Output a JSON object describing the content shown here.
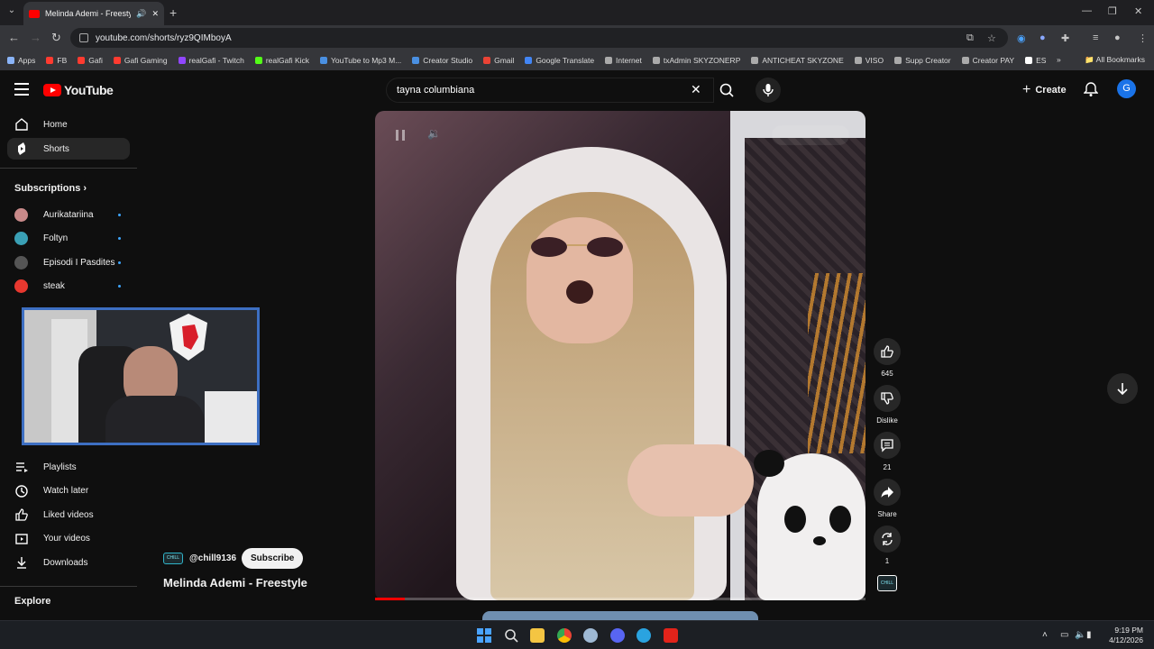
{
  "browser": {
    "tab_title": "Melinda Ademi - Freestyle",
    "tab_audio_icon": "speaker-icon",
    "new_tab_label": "+",
    "url": "youtube.com/shorts/ryz9QIMboyA",
    "bookmarks": [
      {
        "label": "Apps",
        "color": "#8ab4f8"
      },
      {
        "label": "FB",
        "color": "#ff3b30"
      },
      {
        "label": "Gafi",
        "color": "#ff3b30"
      },
      {
        "label": "Gafi Gaming",
        "color": "#ff3b30"
      },
      {
        "label": "realGafi - Twitch",
        "color": "#9146ff"
      },
      {
        "label": "realGafi Kick",
        "color": "#53fc18"
      },
      {
        "label": "YouTube to Mp3 M...",
        "color": "#4a90e2"
      },
      {
        "label": "Creator Studio",
        "color": "#4a90e2"
      },
      {
        "label": "Gmail",
        "color": "#ea4335"
      },
      {
        "label": "Google Translate",
        "color": "#4285f4"
      },
      {
        "label": "Internet",
        "color": "#aaaaaa"
      },
      {
        "label": "txAdmin SKYZONERP",
        "color": "#aaaaaa"
      },
      {
        "label": "ANTICHEAT SKYZONE",
        "color": "#aaaaaa"
      },
      {
        "label": "VISO",
        "color": "#aaaaaa"
      },
      {
        "label": "Supp Creator",
        "color": "#aaaaaa"
      },
      {
        "label": "Creator PAY",
        "color": "#aaaaaa"
      },
      {
        "label": "ES",
        "color": "#ffffff"
      }
    ],
    "all_bookmarks_label": "All Bookmarks"
  },
  "youtube": {
    "logo_text": "YouTube",
    "search_value": "tayna columbiana",
    "create_label": "Create",
    "account_initial": "G",
    "sidebar": {
      "home": "Home",
      "shorts": "Shorts",
      "subscriptions_header": "Subscriptions",
      "subscriptions": [
        {
          "name": "Aurikatariina",
          "color": "#c98a8a"
        },
        {
          "name": "Foltyn",
          "color": "#3aa0b5"
        },
        {
          "name": "Episodi I Pasdites",
          "color": "#555555"
        },
        {
          "name": "steak",
          "color": "#e8382f"
        }
      ],
      "you_items": [
        {
          "label": "Playlists",
          "icon": "playlists-icon"
        },
        {
          "label": "Watch later",
          "icon": "clock-icon"
        },
        {
          "label": "Liked videos",
          "icon": "thumbs-up-icon"
        },
        {
          "label": "Your videos",
          "icon": "play-square-icon"
        },
        {
          "label": "Downloads",
          "icon": "download-icon"
        }
      ],
      "explore_header": "Explore"
    },
    "short": {
      "channel_handle": "@chill9136",
      "channel_badge": "CHILL",
      "subscribe_label": "Subscribe",
      "title": "Melinda Ademi - Freestyle",
      "progress_fraction": 0.06
    },
    "actions": {
      "like_count": "645",
      "dislike_label": "Dislike",
      "comment_count": "21",
      "share_label": "Share",
      "remix_count": "1"
    }
  },
  "taskbar": {
    "time": "9:19 PM",
    "date": "4/12/2026",
    "apps": [
      {
        "name": "start",
        "color": "#4aa3ff"
      },
      {
        "name": "search",
        "color": "#dddddd"
      },
      {
        "name": "file-explorer",
        "color": "#f4c542"
      },
      {
        "name": "chrome",
        "color": "#ea4335"
      },
      {
        "name": "steam",
        "color": "#9fb9d4"
      },
      {
        "name": "discord",
        "color": "#5865f2"
      },
      {
        "name": "telegram",
        "color": "#2aa3e0"
      },
      {
        "name": "adobe",
        "color": "#e2231a"
      }
    ]
  },
  "colors": {
    "accent_red": "#ff0000",
    "link_blue": "#3ea6ff"
  }
}
